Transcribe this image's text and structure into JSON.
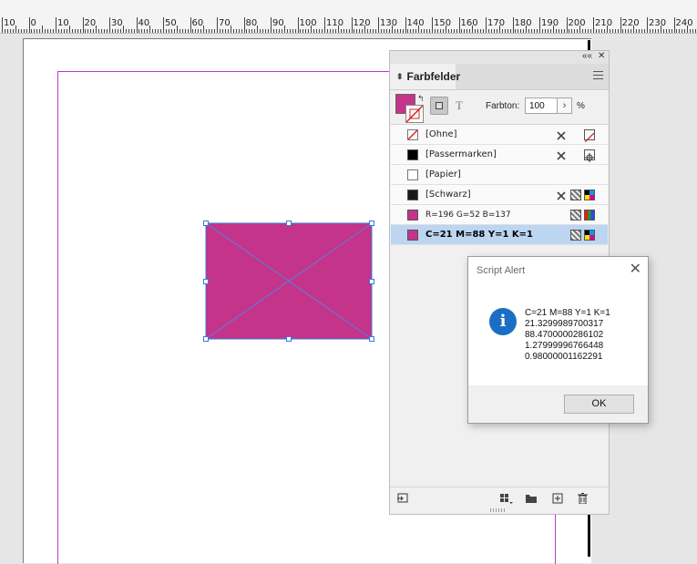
{
  "ruler": {
    "labels": [
      "10",
      "0",
      "10",
      "20",
      "30",
      "40",
      "50",
      "60",
      "70",
      "80",
      "90",
      "100",
      "110",
      "120",
      "130",
      "140",
      "150",
      "160",
      "170",
      "180",
      "190",
      "200",
      "210",
      "220",
      "230",
      "240"
    ]
  },
  "panel": {
    "title": "Farbfelder",
    "tint_label": "Farbton:",
    "tint_value": "100",
    "tint_unit": "%",
    "text_icon": "T",
    "collapse_icon": "««",
    "close_icon": "✕",
    "swatches": [
      {
        "name": "[Ohne]",
        "color": "none"
      },
      {
        "name": "[Passermarken]",
        "color": "#000000"
      },
      {
        "name": "[Papier]",
        "color": "#ffffff"
      },
      {
        "name": "[Schwarz]",
        "color": "#1a1a1a"
      },
      {
        "name": "R=196 G=52 B=137",
        "color": "#c43489"
      },
      {
        "name": "C=21 M=88 Y=1 K=1",
        "color": "#c4348a",
        "selected": true
      }
    ]
  },
  "colors": {
    "frame_fill": "#c4348a",
    "guide": "#b83cc8",
    "selection": "#3a78d8",
    "info": "#1a6fc4"
  },
  "alert": {
    "title": "Script Alert",
    "icon": "i",
    "close": "✕",
    "lines": [
      "C=21 M=88 Y=1 K=1",
      "21.3299989700317",
      "88.4700000286102",
      "1.27999996766448",
      "0.98000001162291"
    ],
    "ok_label": "OK"
  }
}
